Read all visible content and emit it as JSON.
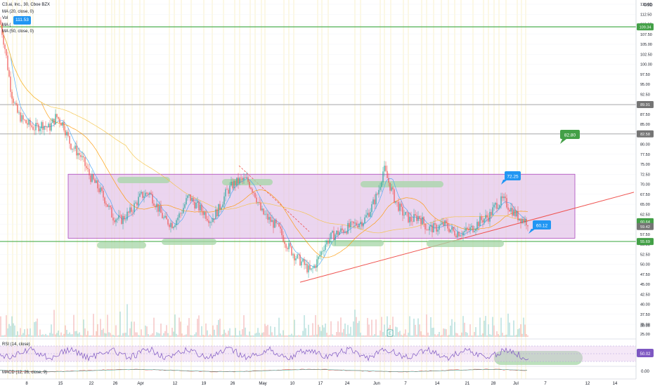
{
  "header": {
    "symbol_line": "C3.ai, Inc., 30, Cboe BZX",
    "indicators": [
      "MA (20, close, 0)",
      "Vol",
      "MA (",
      "MA (50, close, 0)"
    ],
    "crosshair_value": "111.53"
  },
  "currency": "USD",
  "colors": {
    "box_fill": "#e1bee7",
    "box_border": "#ab47bc",
    "support_line": "#ef5350",
    "green_level": "#4caf50",
    "gray_level": "#9e9e9e",
    "blue_label": "#2196f3",
    "green_label": "#43a047",
    "ma_yellow": "#f5c242",
    "ma_orange": "#ff9800",
    "ma_blue": "#42a5f5",
    "candle_up": "#26a69a",
    "candle_down": "#ef5350",
    "rsi_line": "#7e57c2"
  },
  "price_axis": {
    "min": 0.0,
    "max": 115.0,
    "tick_labels": [
      "115.00",
      "112.50",
      "110.00",
      "107.50",
      "105.00",
      "102.50",
      "100.00",
      "97.50",
      "95.00",
      "92.50",
      "90.00",
      "87.50",
      "85.00",
      "82.50",
      "80.00",
      "77.50",
      "75.00",
      "72.50",
      "70.00",
      "67.50",
      "65.00",
      "62.50",
      "60.00",
      "57.50",
      "55.00",
      "52.50",
      "50.00",
      "47.50",
      "45.00",
      "42.50",
      "40.00",
      "37.50",
      "35.00",
      "30.00",
      "25.00",
      "0.00"
    ],
    "badges": [
      {
        "label": "109.34",
        "value": 109.34,
        "color": "#43a047"
      },
      {
        "label": "89.91",
        "value": 89.91,
        "color": "#757575"
      },
      {
        "label": "82.58",
        "value": 82.58,
        "color": "#757575"
      },
      {
        "label": "60.64",
        "value": 60.64,
        "color": "#43a047"
      },
      {
        "label": "59.42",
        "value": 59.42,
        "color": "#757575"
      },
      {
        "label": "55.69",
        "value": 55.69,
        "color": "#43a047"
      }
    ]
  },
  "time_axis": {
    "labels": [
      "8",
      "15",
      "22",
      "26",
      "Apr",
      "12",
      "19",
      "26",
      "May",
      "10",
      "17",
      "24",
      "Jun",
      "7",
      "14",
      "21",
      "28",
      "Jul",
      "7",
      "12",
      "14"
    ]
  },
  "levels": [
    {
      "value": 109.34,
      "kind": "green"
    },
    {
      "value": 89.91,
      "kind": "gray"
    },
    {
      "value": 82.58,
      "kind": "gray"
    },
    {
      "value": 55.69,
      "kind": "green"
    }
  ],
  "range_box": {
    "top": 72.5,
    "bottom": 56.5
  },
  "support_line": {
    "start_value": 45.5,
    "end_value": 68.0
  },
  "price_labels": [
    {
      "text": "111.53"
    },
    {
      "text": "82.80"
    },
    {
      "text": "72.25"
    },
    {
      "text": "60.12"
    }
  ],
  "volume_marker": "E",
  "rsi": {
    "label": "RSI (14, close)",
    "value": "50.02",
    "levels": [
      "75.00",
      "50.00",
      "25.00"
    ]
  },
  "macd": {
    "label": "MACD (12, 26, close, 9)",
    "value": "0.00"
  }
}
